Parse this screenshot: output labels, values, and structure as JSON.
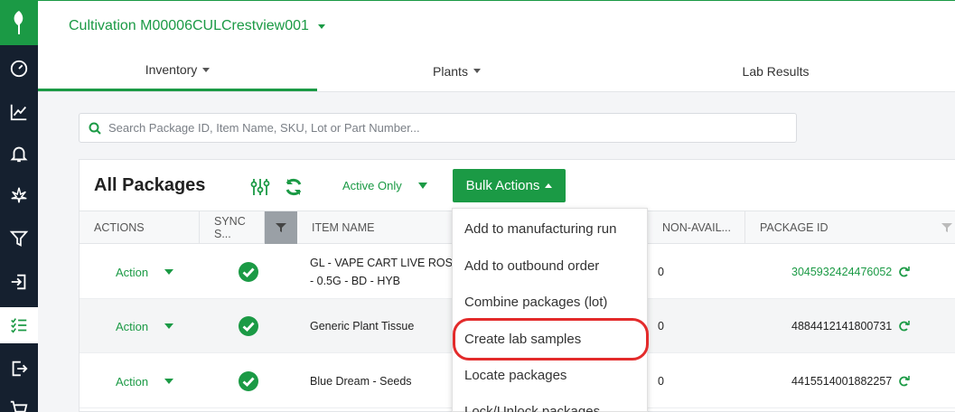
{
  "header": {
    "facility_name": "Cultivation M00006CULCrestview001"
  },
  "tabs": [
    {
      "label": "Inventory",
      "has_caret": true,
      "active": true
    },
    {
      "label": "Plants",
      "has_caret": true,
      "active": false
    },
    {
      "label": "Lab Results",
      "has_caret": false,
      "active": false
    }
  ],
  "search": {
    "placeholder": "Search Package ID, Item Name, SKU, Lot or Part Number..."
  },
  "panel": {
    "title": "All Packages",
    "filter_value": "Active Only",
    "bulk_actions_label": "Bulk Actions"
  },
  "table": {
    "columns": [
      "ACTIONS",
      "SYNC S...",
      "ITEM NAME",
      "NON-AVAIL...",
      "PACKAGE ID"
    ],
    "rows": [
      {
        "action": "Action",
        "item_line1": "GL - VAPE CART LIVE ROSIN",
        "item_line2": "- 0.5G - BD - HYB",
        "non_avail": "0",
        "package_id": "3045932424476052",
        "package_link": true
      },
      {
        "action": "Action",
        "item_line1": "Generic Plant Tissue",
        "item_line2": "",
        "non_avail": "0",
        "package_id": "4884412141800731",
        "package_link": false
      },
      {
        "action": "Action",
        "item_line1": "Blue Dream - Seeds",
        "item_line2": "",
        "non_avail": "0",
        "package_id": "4415514001882257",
        "package_link": false
      }
    ]
  },
  "bulk_menu": {
    "items": [
      "Add to manufacturing run",
      "Add to outbound order",
      "Combine packages (lot)",
      "Create lab samples",
      "Locate packages",
      "Lock/Unlock packages"
    ],
    "highlighted_item": "Create lab samples"
  },
  "sidebar": {
    "icons": [
      "leaf-logo-icon",
      "dashboard-gauge-icon",
      "chart-line-icon",
      "bell-icon",
      "cannabis-leaf-icon",
      "funnel-icon",
      "sign-in-icon",
      "checklist-icon",
      "sign-out-icon",
      "cart-icon"
    ],
    "active_icon": "checklist-icon"
  },
  "colors": {
    "brand_green": "#1b9a45",
    "sidebar_bg": "#15202f",
    "highlight_red": "#e32b2b"
  }
}
